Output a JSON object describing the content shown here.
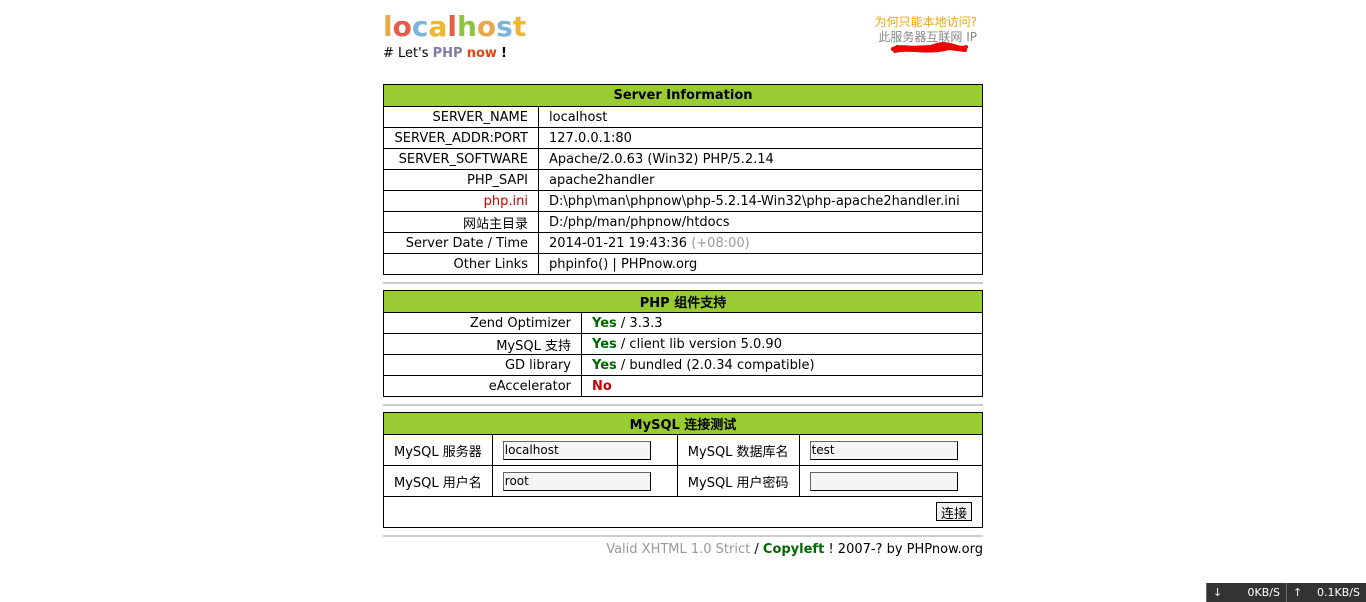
{
  "logo": {
    "letters": [
      "l",
      "o",
      "c",
      "a",
      "l",
      "h",
      "o",
      "s",
      "t"
    ],
    "colors": [
      "#e8a84b",
      "#e75c48",
      "#7ab6d9",
      "#f0b72e",
      "#e75c48",
      "#8fc53e",
      "#e8a84b",
      "#7ab6d9",
      "#f0b72e"
    ]
  },
  "tagline": {
    "hash": "# Let's",
    "php": "PHP",
    "now": "now",
    "bang": "!"
  },
  "topright": {
    "question": "为何只能本地访问?",
    "ip_label": "此服务器互联网 IP"
  },
  "server": {
    "title": "Server Information",
    "rows": [
      {
        "k": "SERVER_NAME",
        "v": "localhost"
      },
      {
        "k": "SERVER_ADDR:PORT",
        "v": "127.0.0.1:80"
      },
      {
        "k": "SERVER_SOFTWARE",
        "v": "Apache/2.0.63 (Win32) PHP/5.2.14"
      },
      {
        "k": "PHP_SAPI",
        "v": "apache2handler"
      },
      {
        "k": "php.ini",
        "v": "D:\\php\\man\\phpnow\\php-5.2.14-Win32\\php-apache2handler.ini"
      },
      {
        "k": "网站主目录",
        "v": "D:/php/man/phpnow/htdocs"
      },
      {
        "k": "Server Date / Time",
        "v": "2014-01-21 19:43:36",
        "tz": "(+08:00)"
      },
      {
        "k": "Other Links",
        "link1": "phpinfo()",
        "sep": "|",
        "link2": "PHPnow.org"
      }
    ]
  },
  "php": {
    "title": "PHP 组件支持",
    "rows": [
      {
        "k": "Zend Optimizer",
        "yes": "Yes",
        "v": "/ 3.3.3"
      },
      {
        "k": "MySQL 支持",
        "yes": "Yes",
        "v": "/ client lib version 5.0.90"
      },
      {
        "k": "GD library",
        "yes": "Yes",
        "v": "/ bundled (2.0.34 compatible)"
      },
      {
        "k": "eAccelerator",
        "no": "No"
      }
    ]
  },
  "mysql": {
    "title": "MySQL 连接测试",
    "server_label": "MySQL 服务器",
    "server_value": "localhost",
    "db_label": "MySQL 数据库名",
    "db_value": "test",
    "user_label": "MySQL 用户名",
    "user_value": "root",
    "pass_label": "MySQL 用户密码",
    "pass_value": "",
    "connect": "连接"
  },
  "footer": {
    "valid": "Valid XHTML 1.0 Strict",
    "slash": "/",
    "copyleft": "Copyleft",
    "rest": "! 2007-? by PHPnow.org"
  },
  "netbar": {
    "down": "0KB/S",
    "up": "0.1KB/S",
    "down_icon": "down-arrow",
    "up_icon": "up-arrow"
  }
}
